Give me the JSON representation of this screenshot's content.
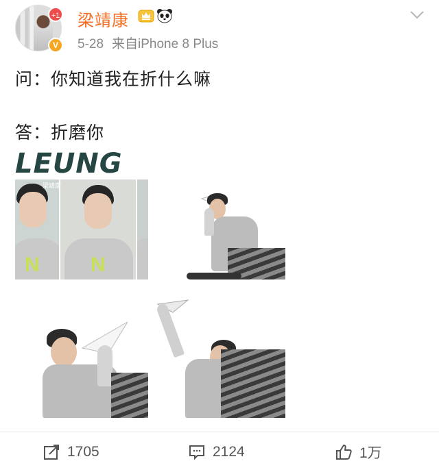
{
  "post": {
    "author": {
      "name": "梁靖康",
      "avatar_badge": "+1",
      "verified_badge": "V",
      "name_color": "#f36c21"
    },
    "date": "5-28",
    "source": "来自iPhone 8 Plus",
    "text": {
      "question": "问：你知道我在折什么嘛",
      "answer": "答：折磨你"
    },
    "images": [
      {
        "title": "LEUNG",
        "caption": "梁靖康"
      },
      {},
      {},
      {}
    ]
  },
  "actions": {
    "share_count": "1705",
    "comment_count": "2124",
    "like_count": "1万"
  },
  "icons": {
    "crown": "crown-icon",
    "panda": "panda-icon",
    "chevron": "chevron-down-icon",
    "share": "share-icon",
    "comment": "comment-icon",
    "like": "thumbs-up-icon"
  }
}
